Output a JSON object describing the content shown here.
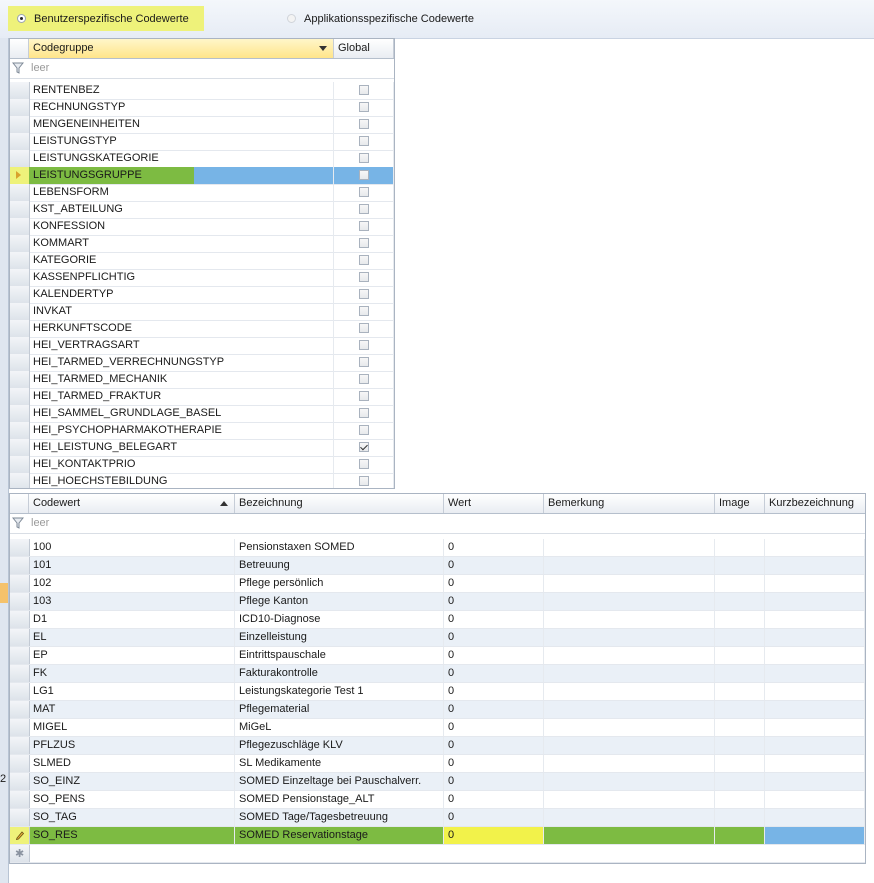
{
  "radio": {
    "user_label": "Benutzerspezifische Codewerte",
    "app_label": "Applikationsspezifische Codewerte"
  },
  "left_strip": {
    "label": "2"
  },
  "colors": {
    "highlight_yellow": "#eef27a",
    "row_green": "#7dbb42",
    "row_blue": "#77b4e6",
    "edit_yellow": "#f2f24a"
  },
  "grid1": {
    "columns": {
      "codegruppe": "Codegruppe",
      "global": "Global"
    },
    "filter_placeholder": "leer",
    "rows": [
      {
        "name": "RENTENBEZ",
        "global": false
      },
      {
        "name": "RECHNUNGSTYP",
        "global": false
      },
      {
        "name": "MENGENEINHEITEN",
        "global": false
      },
      {
        "name": "LEISTUNGSTYP",
        "global": false
      },
      {
        "name": "LEISTUNGSKATEGORIE",
        "global": false
      },
      {
        "name": "LEISTUNGSGRUPPE",
        "global": false
      },
      {
        "name": "LEBENSFORM",
        "global": false
      },
      {
        "name": "KST_ABTEILUNG",
        "global": false
      },
      {
        "name": "KONFESSION",
        "global": false
      },
      {
        "name": "KOMMART",
        "global": false
      },
      {
        "name": "KATEGORIE",
        "global": false
      },
      {
        "name": "KASSENPFLICHTIG",
        "global": false
      },
      {
        "name": "KALENDERTYP",
        "global": false
      },
      {
        "name": "INVKAT",
        "global": false
      },
      {
        "name": "HERKUNFTSCODE",
        "global": false
      },
      {
        "name": "HEI_VERTRAGSART",
        "global": false
      },
      {
        "name": "HEI_TARMED_VERRECHNUNGSTYP",
        "global": false
      },
      {
        "name": "HEI_TARMED_MECHANIK",
        "global": false
      },
      {
        "name": "HEI_TARMED_FRAKTUR",
        "global": false
      },
      {
        "name": "HEI_SAMMEL_GRUNDLAGE_BASEL",
        "global": false
      },
      {
        "name": "HEI_PSYCHOPHARMAKOTHERAPIE",
        "global": false
      },
      {
        "name": "HEI_LEISTUNG_BELEGART",
        "global": true
      },
      {
        "name": "HEI_KONTAKTPRIO",
        "global": false
      },
      {
        "name": "HEI_HOECHSTEBILDUNG",
        "global": false
      }
    ]
  },
  "grid2": {
    "columns": {
      "codewert": "Codewert",
      "bezeichnung": "Bezeichnung",
      "wert": "Wert",
      "bemerkung": "Bemerkung",
      "image": "Image",
      "kurzbezeichnung": "Kurzbezeichnung"
    },
    "filter_placeholder": "leer",
    "rows": [
      {
        "codewert": "100",
        "bezeichnung": "Pensionstaxen SOMED",
        "wert": "0"
      },
      {
        "codewert": "101",
        "bezeichnung": "Betreuung",
        "wert": "0"
      },
      {
        "codewert": "102",
        "bezeichnung": "Pflege persönlich",
        "wert": "0"
      },
      {
        "codewert": "103",
        "bezeichnung": "Pflege Kanton",
        "wert": "0"
      },
      {
        "codewert": "D1",
        "bezeichnung": "ICD10-Diagnose",
        "wert": "0"
      },
      {
        "codewert": "EL",
        "bezeichnung": "Einzelleistung",
        "wert": "0"
      },
      {
        "codewert": "EP",
        "bezeichnung": "Eintrittspauschale",
        "wert": "0"
      },
      {
        "codewert": "FK",
        "bezeichnung": "Fakturakontrolle",
        "wert": "0"
      },
      {
        "codewert": "LG1",
        "bezeichnung": "Leistungskategorie Test 1",
        "wert": "0"
      },
      {
        "codewert": "MAT",
        "bezeichnung": "Pflegematerial",
        "wert": "0"
      },
      {
        "codewert": "MIGEL",
        "bezeichnung": "MiGeL",
        "wert": "0"
      },
      {
        "codewert": "PFLZUS",
        "bezeichnung": "Pflegezuschläge KLV",
        "wert": "0"
      },
      {
        "codewert": "SLMED",
        "bezeichnung": "SL Medikamente",
        "wert": "0"
      },
      {
        "codewert": "SO_EINZ",
        "bezeichnung": "SOMED Einzeltage bei Pauschalverr.",
        "wert": "0"
      },
      {
        "codewert": "SO_PENS",
        "bezeichnung": "SOMED Pensionstage_ALT",
        "wert": "0"
      },
      {
        "codewert": "SO_TAG",
        "bezeichnung": "SOMED Tage/Tagesbetreuung",
        "wert": "0"
      },
      {
        "codewert": "SO_RES",
        "bezeichnung": "SOMED Reservationstage",
        "wert": "0"
      }
    ]
  }
}
